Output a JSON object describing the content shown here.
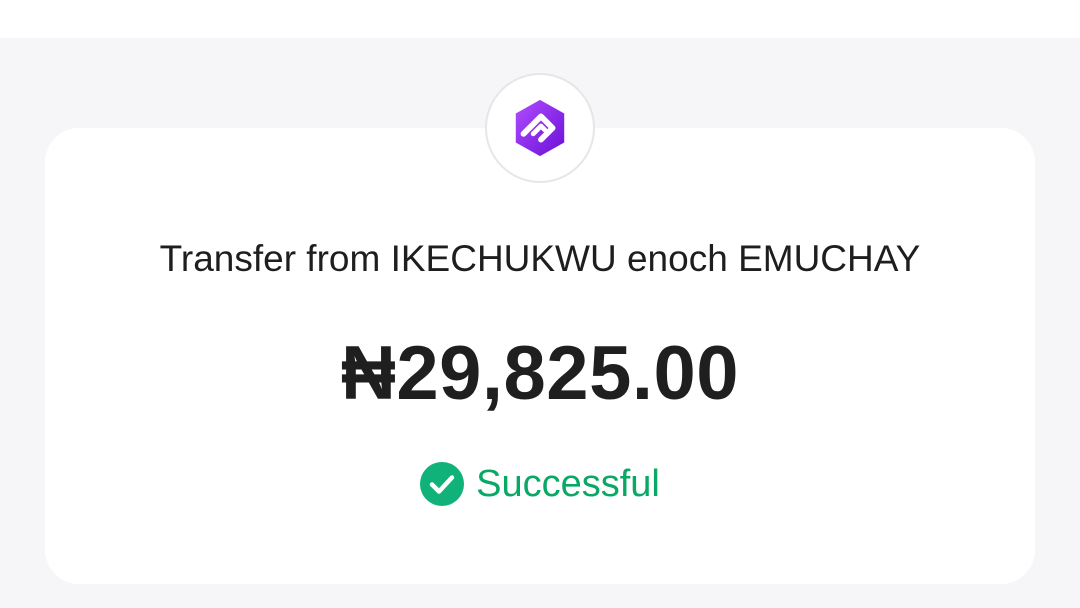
{
  "header": {
    "logo_icon": "bank-logo-icon",
    "logo_color": "#8f2bf5"
  },
  "transaction": {
    "title": "Transfer from IKECHUKWU enoch EMUCHAY",
    "amount": "₦29,825.00",
    "status": {
      "label": "Successful",
      "icon": "check-circle-icon",
      "color": "#0aa866"
    }
  }
}
